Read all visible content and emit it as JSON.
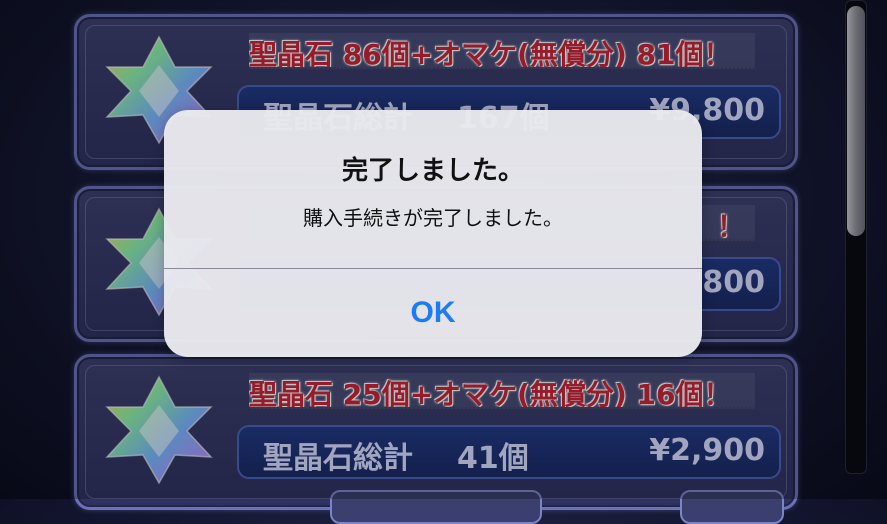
{
  "shop": {
    "items": [
      {
        "title": "聖晶石 86個+オマケ(無償分) 81個！",
        "total_label": "聖晶石総計",
        "total_count": "167個",
        "price": "¥9,800"
      },
      {
        "title": "",
        "total_label": "",
        "total_count": "",
        "price": "800"
      },
      {
        "title": "聖晶石 25個+オマケ(無償分) 16個！",
        "total_label": "聖晶石総計",
        "total_count": "41個",
        "price": "¥2,900"
      }
    ],
    "item2_partial_title_suffix": "！"
  },
  "alert": {
    "title": "完了しました。",
    "message": "購入手続きが完了しました。",
    "ok_label": "OK"
  },
  "colors": {
    "accent": "#1c7cf5",
    "title_red": "#c9253a"
  }
}
